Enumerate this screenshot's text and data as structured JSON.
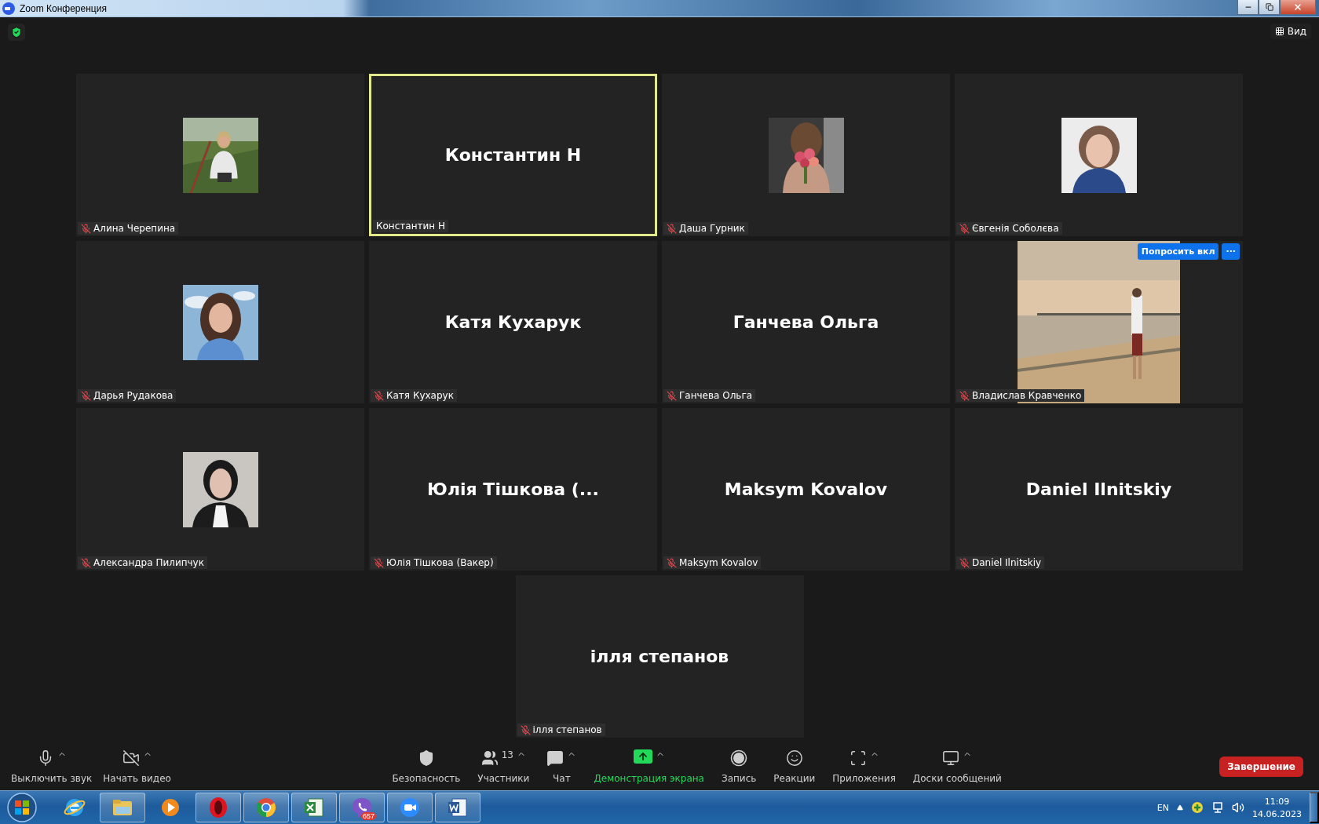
{
  "window": {
    "title": "Zoom Конференция"
  },
  "view_button": {
    "label": "Вид"
  },
  "tiles": [
    {
      "kind": "avatar",
      "name": "Алина Черепина",
      "muted": true,
      "active_speaker": false
    },
    {
      "kind": "name",
      "big_name": "Константин Н",
      "name": "Константин Н",
      "muted": false,
      "active_speaker": true
    },
    {
      "kind": "avatar",
      "name": "Даша Гурник",
      "muted": true,
      "active_speaker": false
    },
    {
      "kind": "avatar",
      "name": "Євгенія Соболєва",
      "muted": true,
      "active_speaker": false
    },
    {
      "kind": "avatar",
      "name": "Дарья Рудакова",
      "muted": true,
      "active_speaker": false
    },
    {
      "kind": "name",
      "big_name": "Катя Кухарук",
      "name": "Катя Кухарук",
      "muted": true,
      "active_speaker": false
    },
    {
      "kind": "name",
      "big_name": "Ганчева Ольга",
      "name": "Ганчева Ольга",
      "muted": true,
      "active_speaker": false
    },
    {
      "kind": "video",
      "name": "Владислав Кравченко",
      "muted": true,
      "active_speaker": false,
      "ask_button": "Попросить вкл",
      "more_button": "···"
    },
    {
      "kind": "avatar",
      "name": "Александра Пилипчук",
      "muted": true,
      "active_speaker": false
    },
    {
      "kind": "name",
      "big_name": "Юлія Тішкова (...",
      "name": "Юлія Тішкова (Вакер)",
      "muted": true,
      "active_speaker": false
    },
    {
      "kind": "name",
      "big_name": "Maksym Kovalov",
      "name": "Maksym Kovalov",
      "muted": true,
      "active_speaker": false
    },
    {
      "kind": "name",
      "big_name": "Daniel Ilnitskiy",
      "name": "Daniel Ilnitskiy",
      "muted": true,
      "active_speaker": false
    },
    {
      "kind": "name",
      "big_name": "ілля степанов",
      "name": "ілля степанов",
      "muted": true,
      "active_speaker": false
    }
  ],
  "toolbar": {
    "left": [
      {
        "kind": "mic",
        "label": "Выключить звук",
        "has_menu": true,
        "highlighted": false
      },
      {
        "kind": "video",
        "label": "Начать видео",
        "has_menu": true,
        "highlighted": false
      }
    ],
    "center": [
      {
        "kind": "security",
        "label": "Безопасность",
        "has_menu": false,
        "highlighted": false
      },
      {
        "kind": "participants",
        "label": "Участники",
        "count": "13",
        "has_menu": true,
        "highlighted": false
      },
      {
        "kind": "chat",
        "label": "Чат",
        "has_menu": true,
        "highlighted": false
      },
      {
        "kind": "share",
        "label": "Демонстрация экрана",
        "has_menu": true,
        "highlighted": true
      },
      {
        "kind": "record",
        "label": "Запись",
        "has_menu": false,
        "highlighted": false
      },
      {
        "kind": "reactions",
        "label": "Реакции",
        "has_menu": false,
        "highlighted": false
      },
      {
        "kind": "apps",
        "label": "Приложения",
        "has_menu": true,
        "highlighted": false
      },
      {
        "kind": "whiteboards",
        "label": "Доски сообщений",
        "has_menu": true,
        "highlighted": false
      }
    ],
    "end_button": "Завершение"
  },
  "taskbar": {
    "apps": [
      {
        "kind": "ie",
        "running": false
      },
      {
        "kind": "explorer",
        "running": true
      },
      {
        "kind": "wmp",
        "running": false
      },
      {
        "kind": "opera",
        "running": true
      },
      {
        "kind": "chrome",
        "running": true
      },
      {
        "kind": "excel",
        "running": true
      },
      {
        "kind": "viber",
        "running": true,
        "badge": "657"
      },
      {
        "kind": "zoom",
        "running": true
      },
      {
        "kind": "word",
        "running": true
      }
    ],
    "language": "EN",
    "time": "11:09",
    "date": "14.06.2023"
  }
}
